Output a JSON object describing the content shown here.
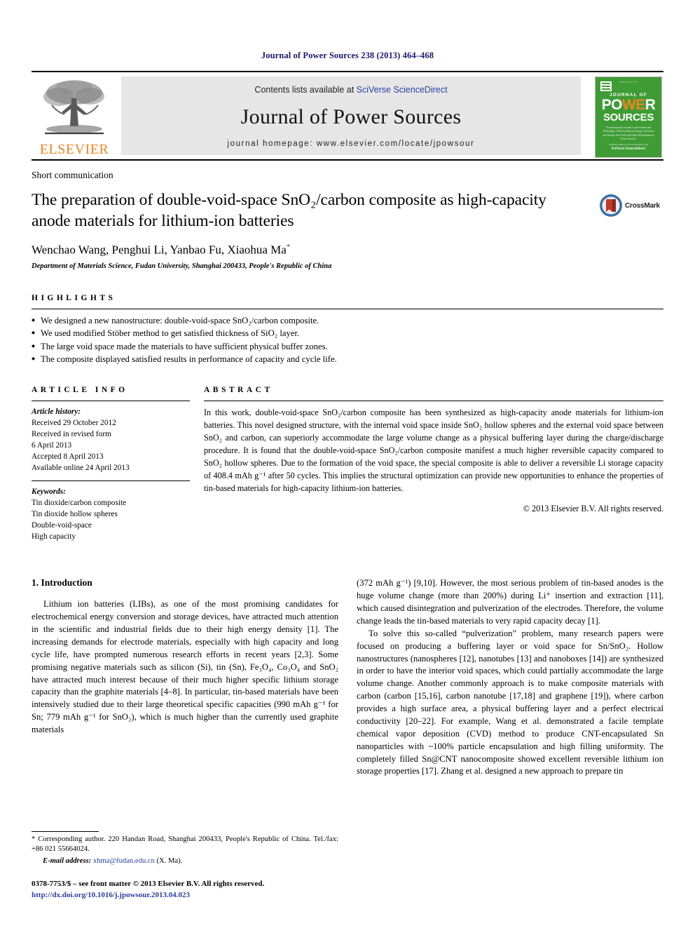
{
  "running_head": "Journal of Power Sources 238 (2013) 464–468",
  "masthead": {
    "publisher_name": "ELSEVIER",
    "contents_prefix": "Contents lists available at ",
    "contents_link": "SciVerse ScienceDirect",
    "journal_title": "Journal of Power Sources",
    "homepage": "journal homepage: www.elsevier.com/locate/jpowsour",
    "cover": {
      "top_text": "ISSN 0378-7753",
      "journal_of": "JOURNAL OF",
      "power": "POWER",
      "power_highlight": "WE",
      "sources": "SOURCES",
      "subtitle": "The International Journal on the Science and Technology of Electrochemical Energy Conversion and Storage, Fuel Cells and Other Electrochemical Power Sources",
      "foot_small": "Available online at www.sciencedirect.com",
      "foot_brand": "SciVerse ScienceDirect"
    }
  },
  "article": {
    "doctype": "Short communication",
    "title": "The preparation of double-void-space SnO₂/carbon composite as high-capacity anode materials for lithium-ion batteries",
    "authors": "Wenchao Wang, Penghui Li, Yanbao Fu, Xiaohua Ma",
    "author_star": "*",
    "affiliation": "Department of Materials Science, Fudan University, Shanghai 200433, People's Republic of China",
    "crossmark_label": "CrossMark"
  },
  "highlights": {
    "heading": "HIGHLIGHTS",
    "items": [
      "We designed a new nanostructure: double-void-space SnO₂/carbon composite.",
      "We used modified Stöber method to get satisfied thickness of SiO₂ layer.",
      "The large void space made the materials to have sufficient physical buffer zones.",
      "The composite displayed satisfied results in performance of capacity and cycle life."
    ]
  },
  "article_info": {
    "heading": "ARTICLE INFO",
    "history_label": "Article history:",
    "history": [
      "Received 29 October 2012",
      "Received in revised form",
      "6 April 2013",
      "Accepted 8 April 2013",
      "Available online 24 April 2013"
    ],
    "keywords_label": "Keywords:",
    "keywords": [
      "Tin dioxide/carbon composite",
      "Tin dioxide hollow spheres",
      "Double-void-space",
      "High capacity"
    ]
  },
  "abstract": {
    "heading": "ABSTRACT",
    "text": "In this work, double-void-space SnO₂/carbon composite has been synthesized as high-capacity anode materials for lithium-ion batteries. This novel designed structure, with the internal void space inside SnO₂ hollow spheres and the external void space between SnO₂ and carbon, can superiorly accommodate the large volume change as a physical buffering layer during the charge/discharge procedure. It is found that the double-void-space SnO₂/carbon composite manifest a much higher reversible capacity compared to SnO₂ hollow spheres. Due to the formation of the void space, the special composite is able to deliver a reversible Li storage capacity of 408.4 mAh g⁻¹ after 50 cycles. This implies the structural optimization can provide new opportunities to enhance the properties of tin-based materials for high-capacity lithium-ion batteries.",
    "copyright": "© 2013 Elsevier B.V. All rights reserved."
  },
  "introduction": {
    "heading": "1. Introduction",
    "left_para_1": "Lithium ion batteries (LIBs), as one of the most promising candidates for electrochemical energy conversion and storage devices, have attracted much attention in the scientific and industrial fields due to their high energy density [1]. The increasing demands for electrode materials, especially with high capacity and long cycle life, have prompted numerous research efforts in recent years [2,3]. Some promising negative materials such as silicon (Si), tin (Sn), Fe₃O₄, Co₃O₄ and SnO₂ have attracted much interest because of their much higher specific lithium storage capacity than the graphite materials [4–8]. In particular, tin-based materials have been intensively studied due to their large theoretical specific capacities (990 mAh g⁻¹ for Sn; 779 mAh g⁻¹ for SnO₂), which is much higher than the currently used graphite materials",
    "right_para_1_cont": "(372 mAh g⁻¹) [9,10]. However, the most serious problem of tin-based anodes is the huge volume change (more than 200%) during Li⁺ insertion and extraction [11], which caused disintegration and pulverization of the electrodes. Therefore, the volume change leads the tin-based materials to very rapid capacity decay [1].",
    "right_para_2": "To solve this so-called “pulverization” problem, many research papers were focused on producing a buffering layer or void space for Sn/SnO₂. Hollow nanostructures (nanospheres [12], nanotubes [13] and nanoboxes [14]) are synthesized in order to have the interior void spaces, which could partially accommodate the large volume change. Another commonly approach is to make composite materials with carbon (carbon [15,16], carbon nanotube [17,18] and graphene [19]), where carbon provides a high surface area, a physical buffering layer and a perfect electrical conductivity [20–22]. For example, Wang et al. demonstrated a facile template chemical vapor deposition (CVD) method to produce CNT-encapsulated Sn nanoparticles with ~100% particle encapsulation and high filling uniformity. The completely filled Sn@CNT nanocomposite showed excellent reversible lithium ion storage properties [17]. Zhang et al. designed a new approach to prepare tin"
  },
  "footnotes": {
    "corresponding": "* Corresponding author. 220 Handan Road, Shanghai 200433, People's Republic of China. Tel./fax: +86 021 55664024.",
    "email_label": "E-mail address:",
    "email": "xhma@fudan.edu.cn",
    "email_suffix": " (X. Ma).",
    "front_matter": "0378-7753/$ – see front matter © 2013 Elsevier B.V. All rights reserved.",
    "doi": "http://dx.doi.org/10.1016/j.jpowsour.2013.04.023"
  },
  "colors": {
    "link": "#2b3fa0",
    "elsevier_orange": "#F0841E",
    "cover_green": "#3f9c35",
    "running_head": "#1a1a6e"
  }
}
